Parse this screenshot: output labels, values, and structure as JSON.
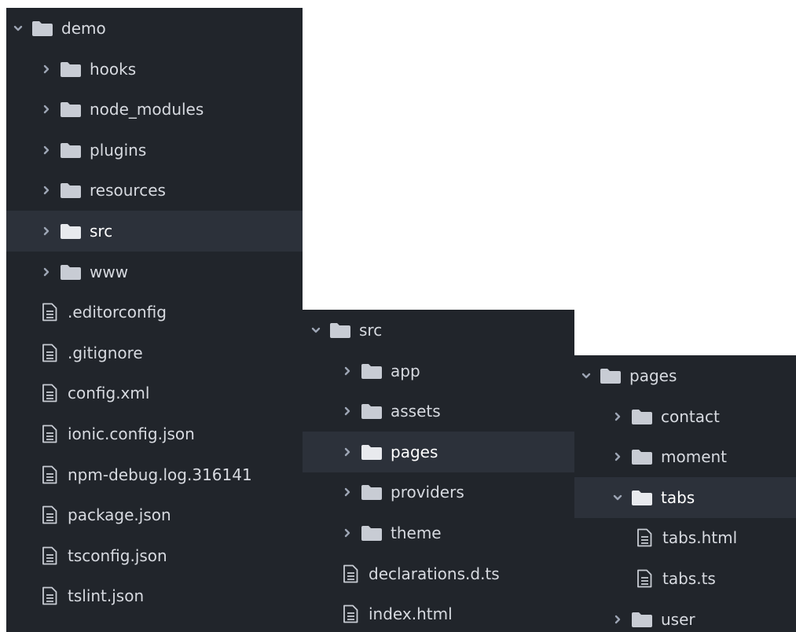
{
  "colors": {
    "panel_bg": "#21252b",
    "selected_bg": "#2c313a",
    "text": "#d7dae0",
    "folder_icon": "#c8ccd4",
    "selected_folder_icon": "#e8eaee",
    "chevron": "#9da5b4"
  },
  "icons": {
    "folder": "folder-icon",
    "file": "file-text-icon",
    "expanded": "chevron-down-icon",
    "collapsed": "chevron-right-icon"
  },
  "panels": [
    {
      "id": "demo",
      "items": [
        {
          "label": "demo",
          "type": "folder",
          "expanded": true,
          "depth": 0
        },
        {
          "label": "hooks",
          "type": "folder",
          "expanded": false,
          "depth": 1
        },
        {
          "label": "node_modules",
          "type": "folder",
          "expanded": false,
          "depth": 1
        },
        {
          "label": "plugins",
          "type": "folder",
          "expanded": false,
          "depth": 1
        },
        {
          "label": "resources",
          "type": "folder",
          "expanded": false,
          "depth": 1
        },
        {
          "label": "src",
          "type": "folder",
          "expanded": false,
          "depth": 1,
          "selected": true
        },
        {
          "label": "www",
          "type": "folder",
          "expanded": false,
          "depth": 1
        },
        {
          "label": ".editorconfig",
          "type": "file",
          "depth": 1
        },
        {
          "label": ".gitignore",
          "type": "file",
          "depth": 1
        },
        {
          "label": "config.xml",
          "type": "file",
          "depth": 1
        },
        {
          "label": "ionic.config.json",
          "type": "file",
          "depth": 1
        },
        {
          "label": "npm-debug.log.316141",
          "type": "file",
          "depth": 1
        },
        {
          "label": "package.json",
          "type": "file",
          "depth": 1
        },
        {
          "label": "tsconfig.json",
          "type": "file",
          "depth": 1
        },
        {
          "label": "tslint.json",
          "type": "file",
          "depth": 1
        }
      ]
    },
    {
      "id": "src",
      "items": [
        {
          "label": "src",
          "type": "folder",
          "expanded": true,
          "depth": 0
        },
        {
          "label": "app",
          "type": "folder",
          "expanded": false,
          "depth": 1
        },
        {
          "label": "assets",
          "type": "folder",
          "expanded": false,
          "depth": 1
        },
        {
          "label": "pages",
          "type": "folder",
          "expanded": false,
          "depth": 1,
          "selected": true
        },
        {
          "label": "providers",
          "type": "folder",
          "expanded": false,
          "depth": 1
        },
        {
          "label": "theme",
          "type": "folder",
          "expanded": false,
          "depth": 1
        },
        {
          "label": "declarations.d.ts",
          "type": "file",
          "depth": 1
        },
        {
          "label": "index.html",
          "type": "file",
          "depth": 1
        }
      ]
    },
    {
      "id": "pages",
      "items": [
        {
          "label": "pages",
          "type": "folder",
          "expanded": true,
          "depth": 0
        },
        {
          "label": "contact",
          "type": "folder",
          "expanded": false,
          "depth": 1
        },
        {
          "label": "moment",
          "type": "folder",
          "expanded": false,
          "depth": 1
        },
        {
          "label": "tabs",
          "type": "folder",
          "expanded": true,
          "depth": 1,
          "selected": true
        },
        {
          "label": "tabs.html",
          "type": "file",
          "depth": 2
        },
        {
          "label": "tabs.ts",
          "type": "file",
          "depth": 2
        },
        {
          "label": "user",
          "type": "folder",
          "expanded": false,
          "depth": 1
        }
      ]
    }
  ]
}
